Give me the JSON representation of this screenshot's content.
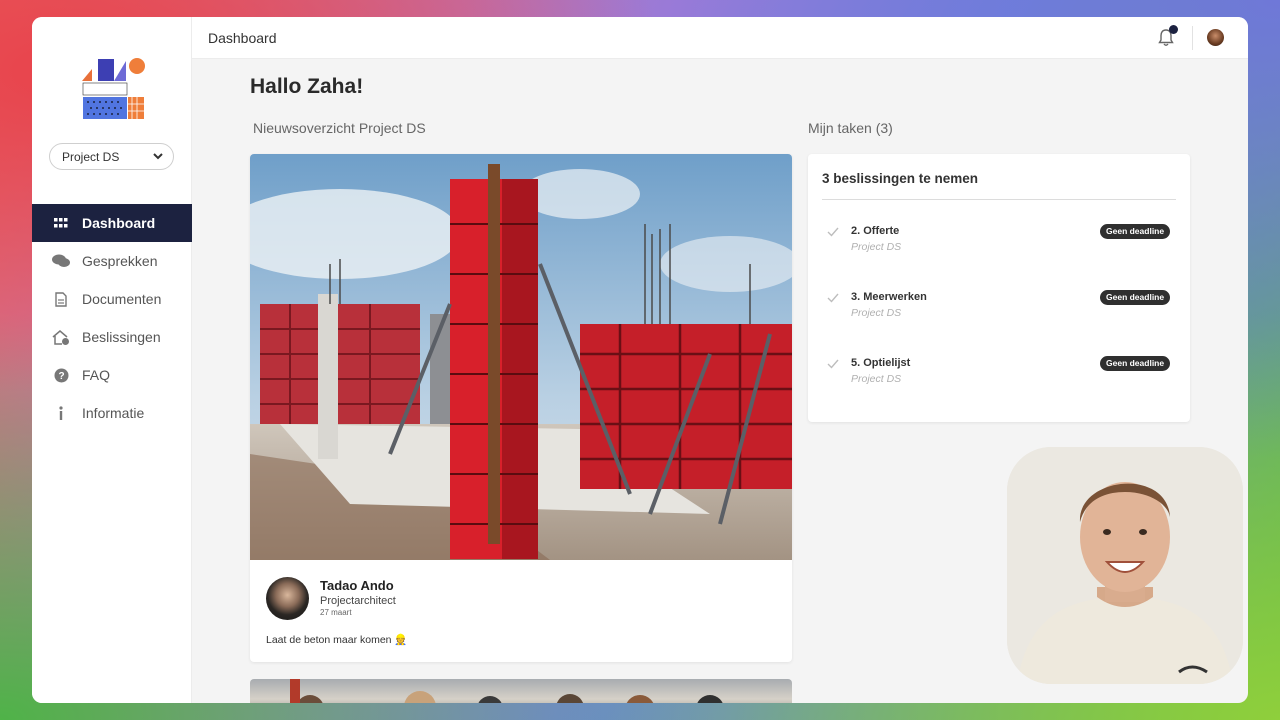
{
  "app": {
    "project_selector": "Project DS",
    "nav": [
      {
        "label": "Dashboard",
        "icon": "grid-icon",
        "active": true
      },
      {
        "label": "Gesprekken",
        "icon": "chat-icon",
        "active": false
      },
      {
        "label": "Documenten",
        "icon": "document-icon",
        "active": false
      },
      {
        "label": "Beslissingen",
        "icon": "house-check-icon",
        "active": false
      },
      {
        "label": "FAQ",
        "icon": "question-icon",
        "active": false
      },
      {
        "label": "Informatie",
        "icon": "info-icon",
        "active": false
      }
    ]
  },
  "header": {
    "title": "Dashboard"
  },
  "main": {
    "greeting": "Hallo Zaha!",
    "news_section_title": "Nieuwsoverzicht Project DS",
    "tasks_section_title": "Mijn taken (3)",
    "news_post": {
      "author": "Tadao Ando",
      "role": "Projectarchitect",
      "date": "27 maart",
      "text": "Laat de beton maar komen 👷"
    },
    "tasks_card": {
      "heading": "3 beslissingen te nemen",
      "tasks": [
        {
          "name": "2. Offerte",
          "project": "Project DS",
          "badge": "Geen deadline"
        },
        {
          "name": "3. Meerwerken",
          "project": "Project DS",
          "badge": "Geen deadline"
        },
        {
          "name": "5. Optielijst",
          "project": "Project DS",
          "badge": "Geen deadline"
        }
      ]
    }
  },
  "colors": {
    "nav_active_bg": "#1c2240",
    "badge_bg": "#2f2f2f",
    "formwork_red": "#d8202b"
  }
}
